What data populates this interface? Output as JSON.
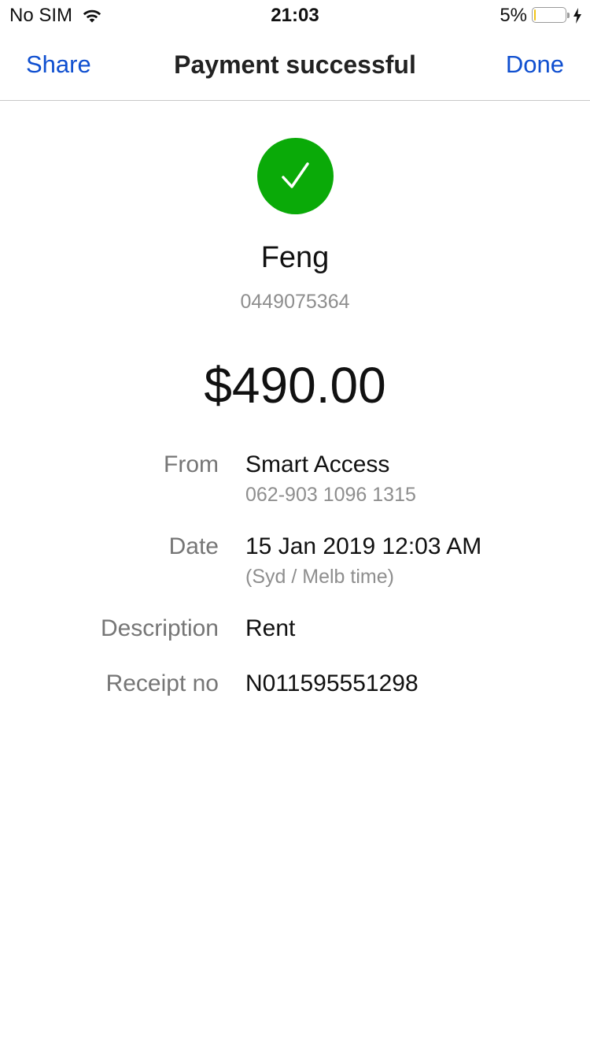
{
  "status_bar": {
    "carrier": "No SIM",
    "time": "21:03",
    "battery_percent": "5%",
    "battery_level": 0.05,
    "battery_color": "#f0c419"
  },
  "nav": {
    "share_label": "Share",
    "title": "Payment successful",
    "done_label": "Done",
    "accent_color": "#0f4fd0"
  },
  "receipt": {
    "status_icon": "checkmark-circle-icon",
    "status_color": "#0aaa08",
    "payee_name": "Feng",
    "payee_phone": "0449075364",
    "amount": "$490.00",
    "details": {
      "from_label": "From",
      "from_value": "Smart Access",
      "from_sub": "062-903 1096 1315",
      "date_label": "Date",
      "date_value": "15 Jan 2019 12:03 AM",
      "date_sub": "(Syd / Melb time)",
      "description_label": "Description",
      "description_value": "Rent",
      "receipt_label": "Receipt no",
      "receipt_value": "N011595551298"
    }
  }
}
